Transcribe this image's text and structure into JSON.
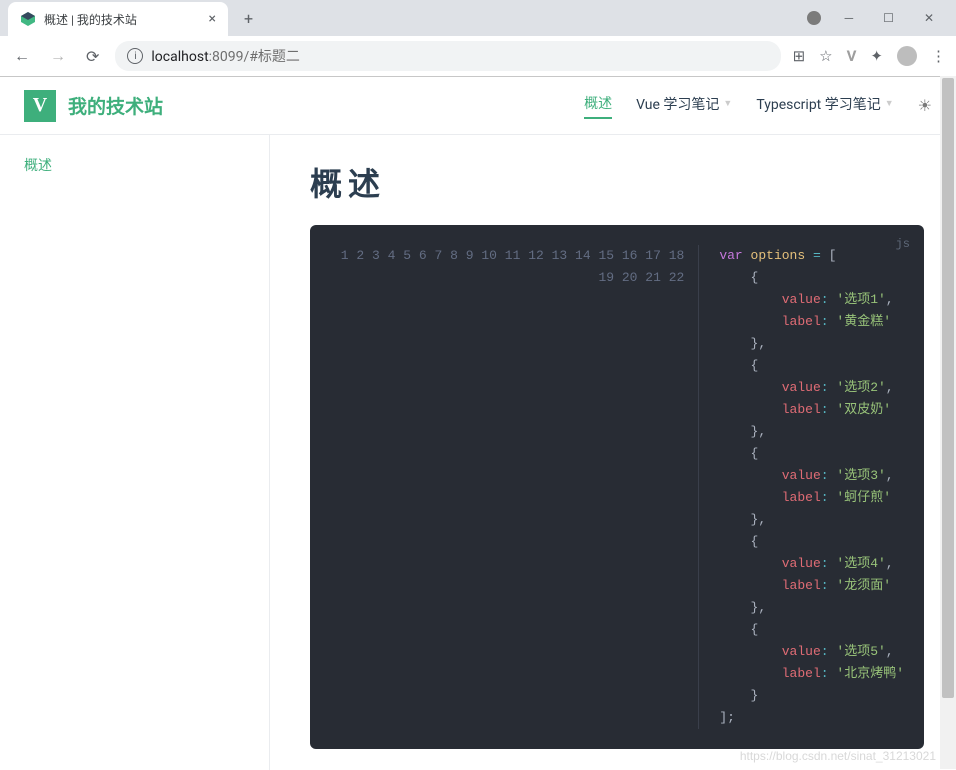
{
  "browser": {
    "tab_title": "概述 | 我的技术站",
    "url_host": "localhost",
    "url_port": ":8099",
    "url_path": "/#标题二"
  },
  "navbar": {
    "site_name": "我的技术站",
    "links": [
      {
        "label": "概述",
        "active": true,
        "dropdown": false
      },
      {
        "label": "Vue 学习笔记",
        "active": false,
        "dropdown": true
      },
      {
        "label": "Typescript 学习笔记",
        "active": false,
        "dropdown": true
      }
    ]
  },
  "sidebar": {
    "items": [
      {
        "label": "概述"
      }
    ]
  },
  "content": {
    "heading": "概述",
    "code_lang": "js",
    "code_lines": [
      "1",
      "2",
      "3",
      "4",
      "5",
      "6",
      "7",
      "8",
      "9",
      "10",
      "11",
      "12",
      "13",
      "14",
      "15",
      "16",
      "17",
      "18",
      "19",
      "20",
      "21",
      "22"
    ],
    "code_tokens": {
      "var": "var",
      "options": "options",
      "eq": "=",
      "lbrack": "[",
      "rbrack": "];",
      "lbrace": "{",
      "rbrace": "}",
      "rbrace_c": "},",
      "value_key": "value",
      "label_key": "label",
      "colon": ":",
      "comma": ",",
      "values": [
        "'选项1'",
        "'选项2'",
        "'选项3'",
        "'选项4'",
        "'选项5'"
      ],
      "labels": [
        "'黄金糕'",
        "'双皮奶'",
        "'蚵仔煎'",
        "'龙须面'",
        "'北京烤鸭'"
      ]
    }
  },
  "watermark": "https://blog.csdn.net/sinat_31213021"
}
